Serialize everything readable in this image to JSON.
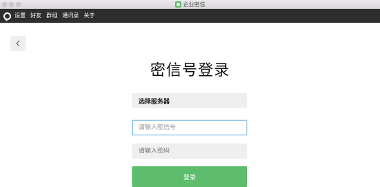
{
  "window": {
    "title": "企业密信"
  },
  "menubar": {
    "logo_icon": "chat-bubble-icon",
    "items": [
      {
        "label": "设置"
      },
      {
        "label": "好友"
      },
      {
        "label": "群组"
      },
      {
        "label": "通讯录"
      },
      {
        "label": "关于"
      }
    ]
  },
  "back_button": {
    "icon": "chevron-left-icon"
  },
  "page": {
    "title": "密信号登录"
  },
  "form": {
    "server_label": "选择服务器",
    "account_placeholder": "请输入密信号",
    "account_value": "",
    "password_placeholder": "请输入密码",
    "password_value": "",
    "submit_label": "登录"
  },
  "colors": {
    "accent_green": "#5dbd6c",
    "menubar_bg": "#2e2e2e",
    "focus_border": "#8fc3e8",
    "field_bg": "#efefef"
  }
}
